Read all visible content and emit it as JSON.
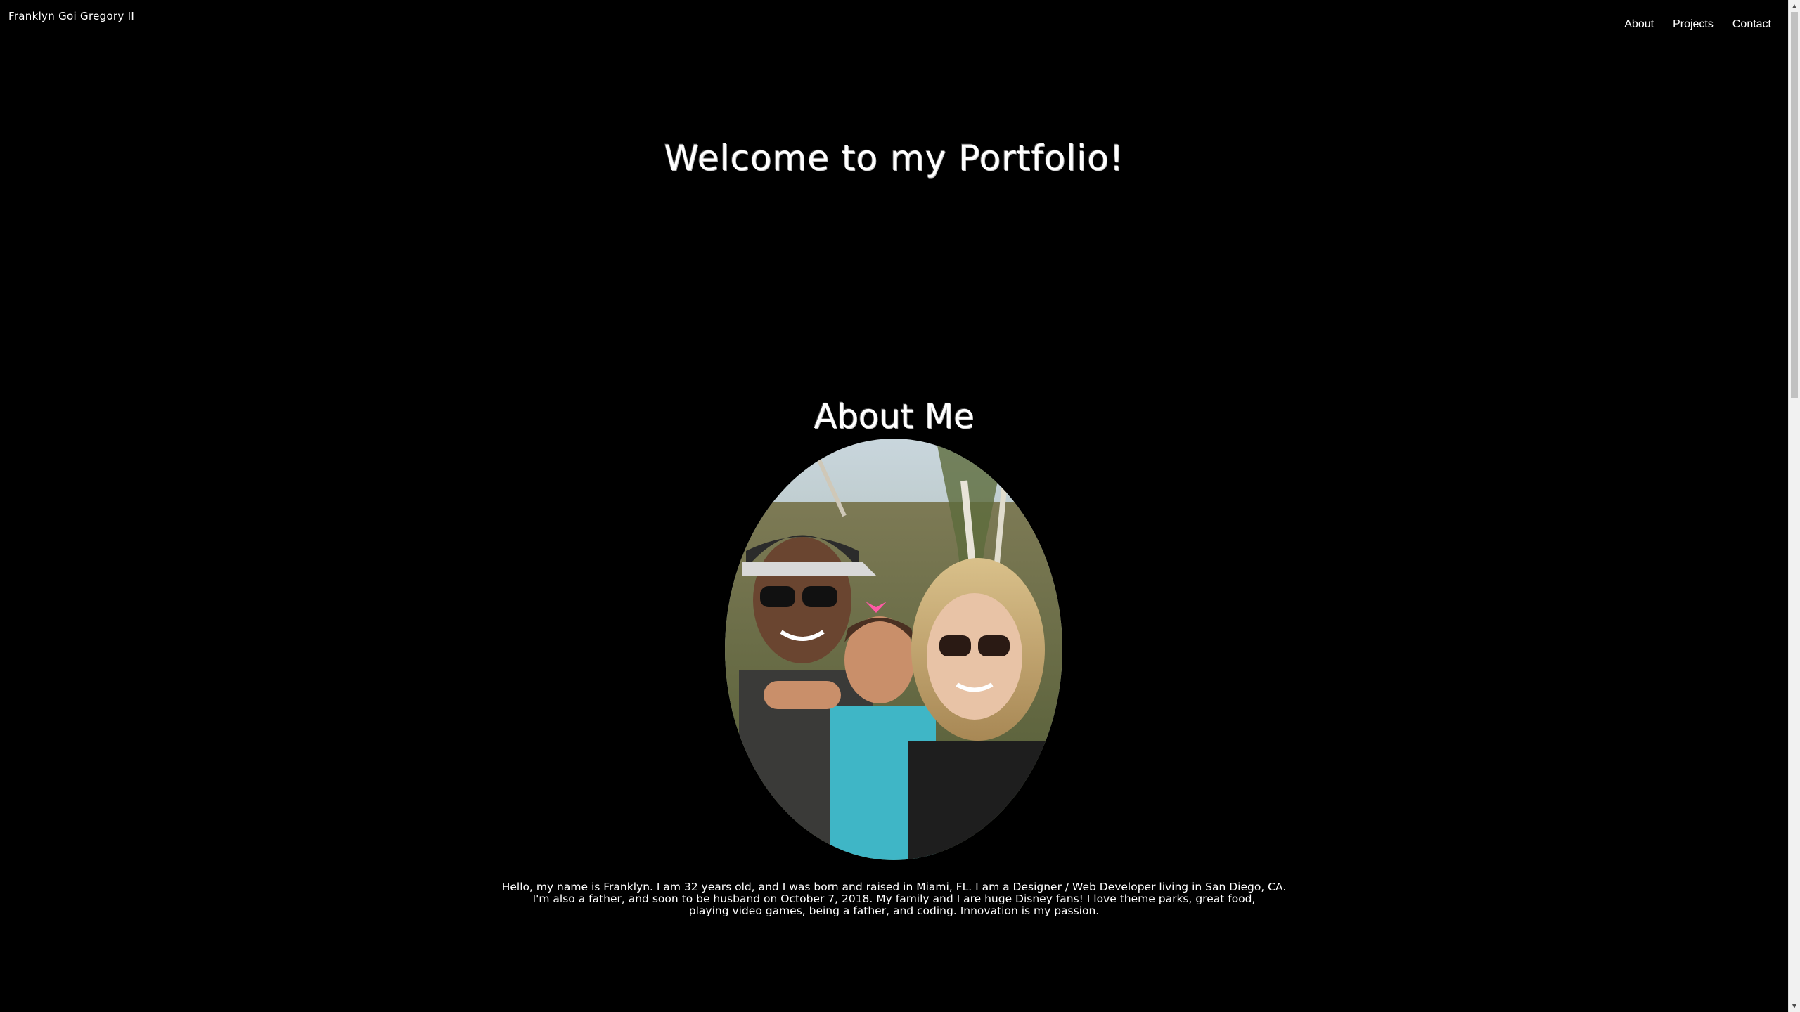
{
  "header": {
    "brand": "Franklyn Goi Gregory II",
    "nav": [
      "About",
      "Projects",
      "Contact"
    ]
  },
  "hero": {
    "title": "Welcome to my Portfolio!"
  },
  "about": {
    "title": "About Me",
    "photo_icon": "family-photo",
    "bio_lines": [
      "Hello, my name is Franklyn. I am 32 years old, and I was born and raised in Miami, FL. I am a Designer / Web Developer living in San Diego, CA.",
      "I'm also a father, and soon to be husband on October 7, 2018. My family and I are huge Disney fans! I love theme parks, great food,",
      "playing video games, being a father, and coding. Innovation is my passion."
    ]
  },
  "scrollbar": {
    "up_icon": "scroll-up-arrow",
    "down_icon": "scroll-down-arrow",
    "up_glyph": "▲",
    "down_glyph": "▼"
  },
  "colors": {
    "background": "#000000",
    "text": "#ffffff"
  }
}
